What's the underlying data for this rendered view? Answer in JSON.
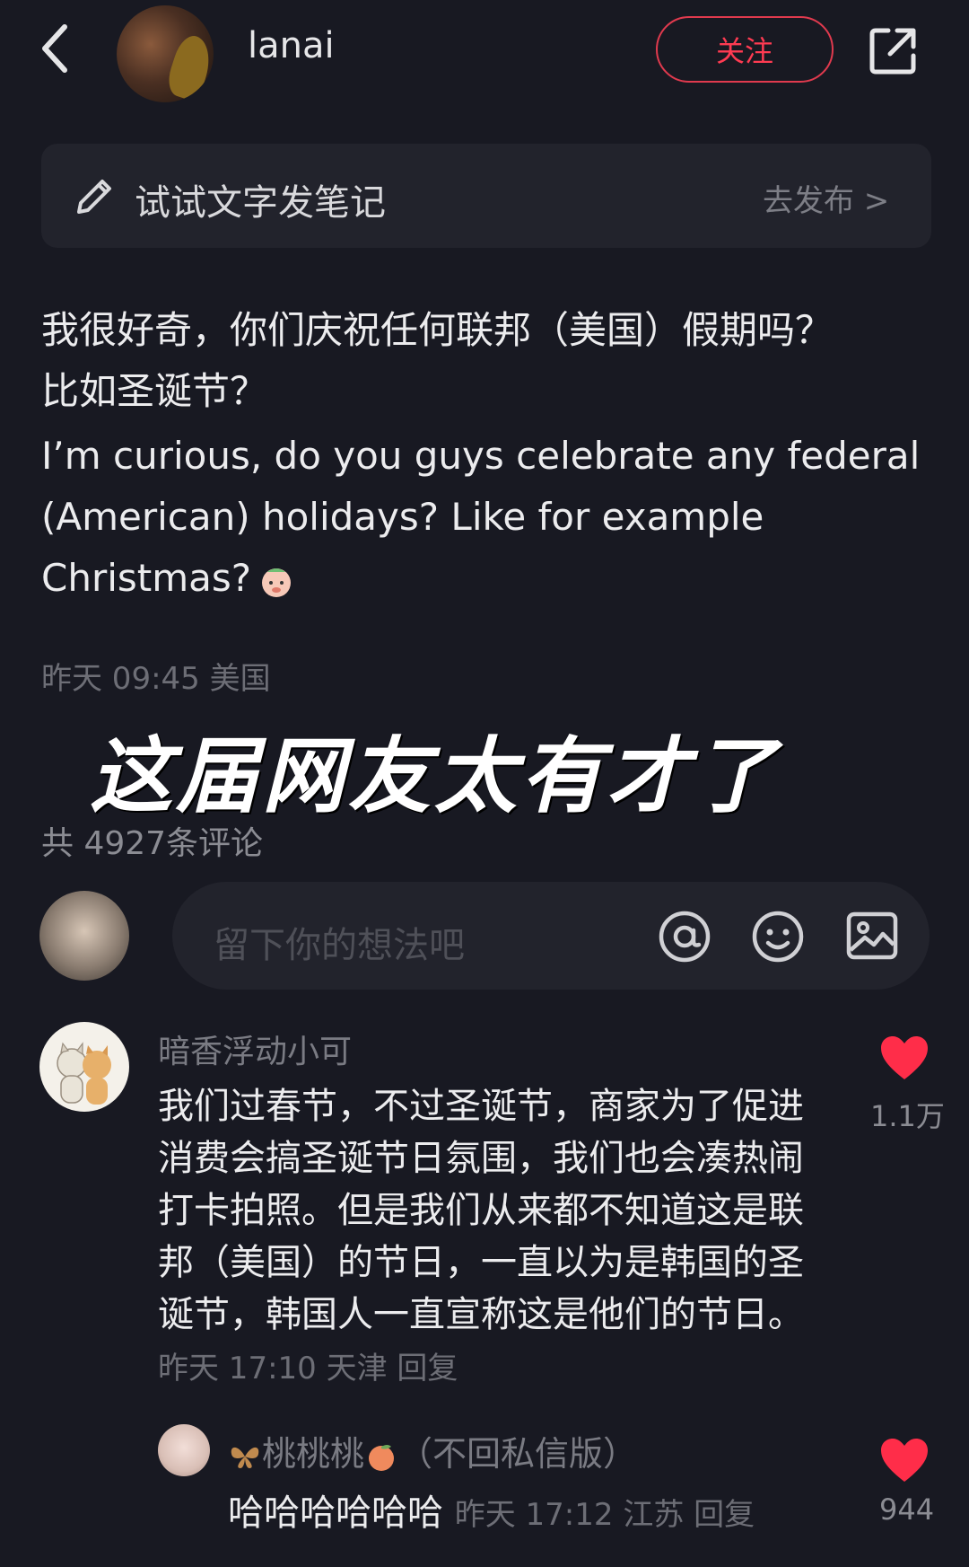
{
  "header": {
    "username": "lanai",
    "follow_label": "关注"
  },
  "draft": {
    "text": "试试文字发笔记",
    "publish_label": "去发布 >"
  },
  "post": {
    "text_zh_line1": "我很好奇，你们庆祝任何联邦（美国）假期吗？",
    "text_zh_line2": "比如圣诞节？",
    "text_en_line1": "I’m curious, do you guys celebrate any federal",
    "text_en_line2": "(American) holidays? Like for example",
    "text_en_line3": "Christmas?",
    "meta": "昨天 09:45 美国",
    "overlay_caption": "这届网友太有才了",
    "comment_count": "共 4927条评论"
  },
  "comment_input": {
    "placeholder": "留下你的想法吧"
  },
  "comments": [
    {
      "author": "暗香浮动小可",
      "body": "我们过春节，不过圣诞节，商家为了促进消费会搞圣诞节日氛围，我们也会凑热闹打卡拍照。但是我们从来都不知道这是联邦（美国）的节日，一直以为是韩国的圣诞节，韩国人一直宣称这是他们的节日。",
      "meta": "昨天 17:10 天津 回复",
      "likes": "1.1万",
      "reply": {
        "author_prefix": "桃桃桃",
        "author_suffix": "（不回私信版）",
        "body": "哈哈哈哈哈哈",
        "meta": "昨天 17:12 江苏 回复",
        "likes": "944"
      }
    }
  ],
  "colors": {
    "background": "#181922",
    "accent": "#ff3b52",
    "heart": "#ff2d49"
  }
}
